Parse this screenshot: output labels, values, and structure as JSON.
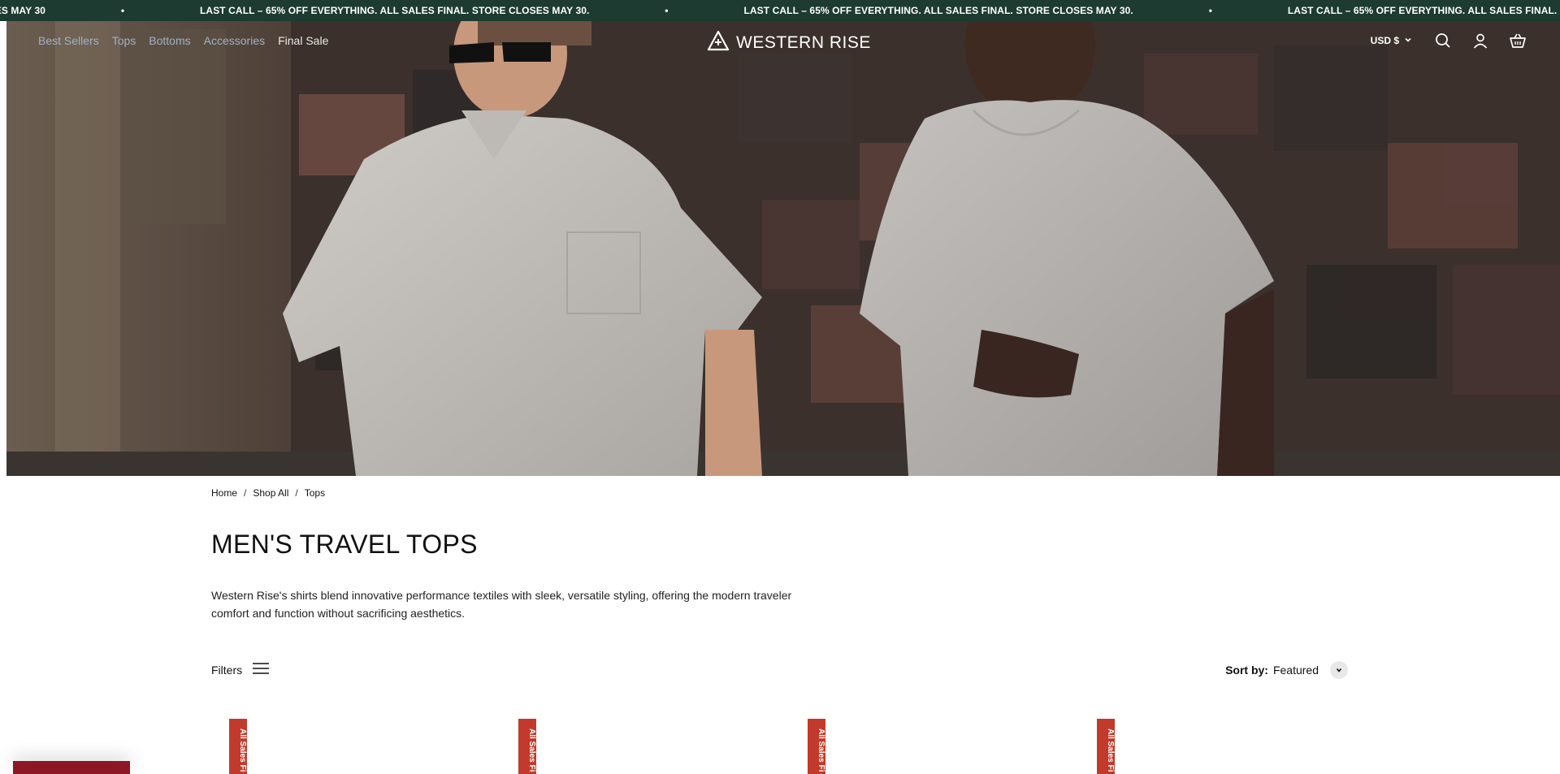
{
  "announcement": {
    "message": "LAST CALL – 65% OFF EVERYTHING. ALL SALES FINAL. STORE CLOSES MAY 30.",
    "partial_start": "CLOSES MAY 30.",
    "separator": "•"
  },
  "header": {
    "nav": [
      "Best Sellers",
      "Tops",
      "Bottoms",
      "Accessories",
      "Final Sale"
    ],
    "logo": "WESTERN RISE",
    "currency": "USD $"
  },
  "breadcrumb": [
    "Home",
    "Shop All",
    "Tops"
  ],
  "page": {
    "title": "MEN'S TRAVEL TOPS",
    "description": "Western Rise's shirts blend innovative performance textiles with sleek, versatile styling, offering the modern traveler comfort and function without sacrificing aesthetics."
  },
  "toolbar": {
    "filters_label": "Filters",
    "sort_label": "Sort by:",
    "sort_value": "Featured"
  },
  "product_tags": [
    "All Sales Fi",
    "All Sales Fi",
    "All Sales Fi",
    "All Sales Fi"
  ],
  "colors": {
    "announcement_bg": "#1d3b30",
    "tag": "#c23a2c",
    "promo": "#8c1825"
  }
}
